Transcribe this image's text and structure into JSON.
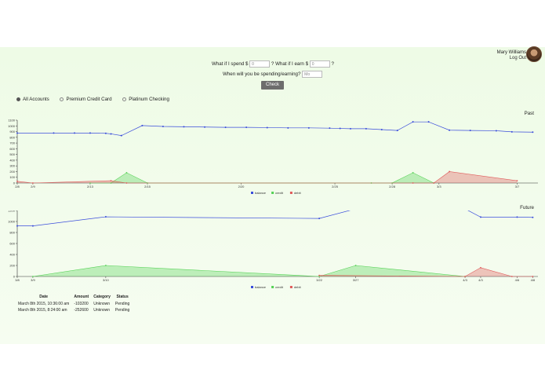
{
  "user": {
    "name": "Mary Williams",
    "logout": "Log Out"
  },
  "whatif": {
    "spend_prefix": "What if I spend $",
    "spend_value": "0",
    "earn_prefix": "? What if I earn $",
    "earn_value": "0",
    "earn_suffix": "?",
    "when_label": "When will you be spending/earning?",
    "when_value": "Mo",
    "check_label": "Check"
  },
  "filters": [
    {
      "label": "All Accounts",
      "selected": true
    },
    {
      "label": "Premium Credit Card",
      "selected": false
    },
    {
      "label": "Platinum Checking",
      "selected": false
    }
  ],
  "legend": {
    "balance": "balance",
    "credit": "credit",
    "debit": "debit"
  },
  "colors": {
    "balance": "#3a4ddb",
    "credit": "#56d256",
    "debit": "#e05a5a",
    "brand_bg": "#eefbe6"
  },
  "chart_data": [
    {
      "type": "line",
      "title": "Past",
      "ylim": [
        0,
        1100
      ],
      "yticks": [
        0,
        100,
        200,
        300,
        400,
        500,
        600,
        700,
        800,
        900,
        1000,
        1100
      ],
      "xlim": [
        0,
        100
      ],
      "xtick_positions": [
        0,
        3,
        14,
        25,
        43,
        61,
        72,
        81,
        96
      ],
      "xtick_labels": [
        "2/8",
        "2/9",
        "2/13",
        "2/15",
        "2/20",
        "2/25",
        "2/28",
        "3/3",
        "3/7"
      ],
      "series": [
        {
          "name": "balance",
          "x": [
            0,
            7,
            11,
            14,
            17,
            18,
            20,
            24,
            28,
            32,
            36,
            40,
            44,
            48,
            52,
            56,
            60,
            62,
            64,
            67,
            70,
            73,
            76,
            79,
            83,
            87,
            92,
            95,
            99
          ],
          "y": [
            875,
            875,
            875,
            875,
            870,
            860,
            830,
            1005,
            990,
            985,
            980,
            975,
            975,
            970,
            965,
            965,
            960,
            955,
            950,
            950,
            935,
            920,
            1070,
            1070,
            925,
            920,
            915,
            895,
            890
          ]
        },
        {
          "name": "credit",
          "x": [
            14,
            18,
            21,
            25,
            68,
            72,
            76,
            80
          ],
          "y": [
            0,
            0,
            180,
            0,
            0,
            0,
            180,
            0
          ]
        },
        {
          "name": "debit",
          "x": [
            0,
            3,
            18,
            21,
            76,
            80,
            83,
            96
          ],
          "y": [
            30,
            0,
            40,
            0,
            0,
            0,
            200,
            40
          ]
        }
      ]
    },
    {
      "type": "line",
      "title": "Future",
      "ylim": [
        0,
        1200
      ],
      "yticks": [
        0,
        200,
        400,
        600,
        800,
        1000,
        1200
      ],
      "xlim": [
        0,
        100
      ],
      "xtick_positions": [
        0,
        3,
        17,
        58,
        65,
        86,
        89,
        96,
        99
      ],
      "xtick_labels": [
        "3/8",
        "3/9",
        "3/10",
        "3/22",
        "3/27",
        "4/3",
        "4/3",
        "4/6",
        "4/8"
      ],
      "series": [
        {
          "name": "balance",
          "x": [
            0,
            3,
            17,
            58,
            65,
            86,
            89,
            96,
            99
          ],
          "y": [
            920,
            920,
            1085,
            1055,
            1230,
            1230,
            1080,
            1080,
            1075
          ]
        },
        {
          "name": "credit",
          "x": [
            3,
            17,
            58,
            65,
            86
          ],
          "y": [
            0,
            200,
            0,
            200,
            0
          ]
        },
        {
          "name": "debit",
          "x": [
            58,
            86,
            89,
            95,
            99
          ],
          "y": [
            20,
            0,
            160,
            0,
            0
          ]
        }
      ]
    }
  ],
  "table": {
    "headers": [
      "Date",
      "Amount",
      "Category",
      "Status"
    ],
    "rows": [
      [
        "March 8th 2015, 10:36:00 am",
        "-103200",
        "Unknown",
        "Pending"
      ],
      [
        "March 8th 2015, 8:24:00 am",
        "-252600",
        "Unknown",
        "Pending"
      ]
    ]
  }
}
